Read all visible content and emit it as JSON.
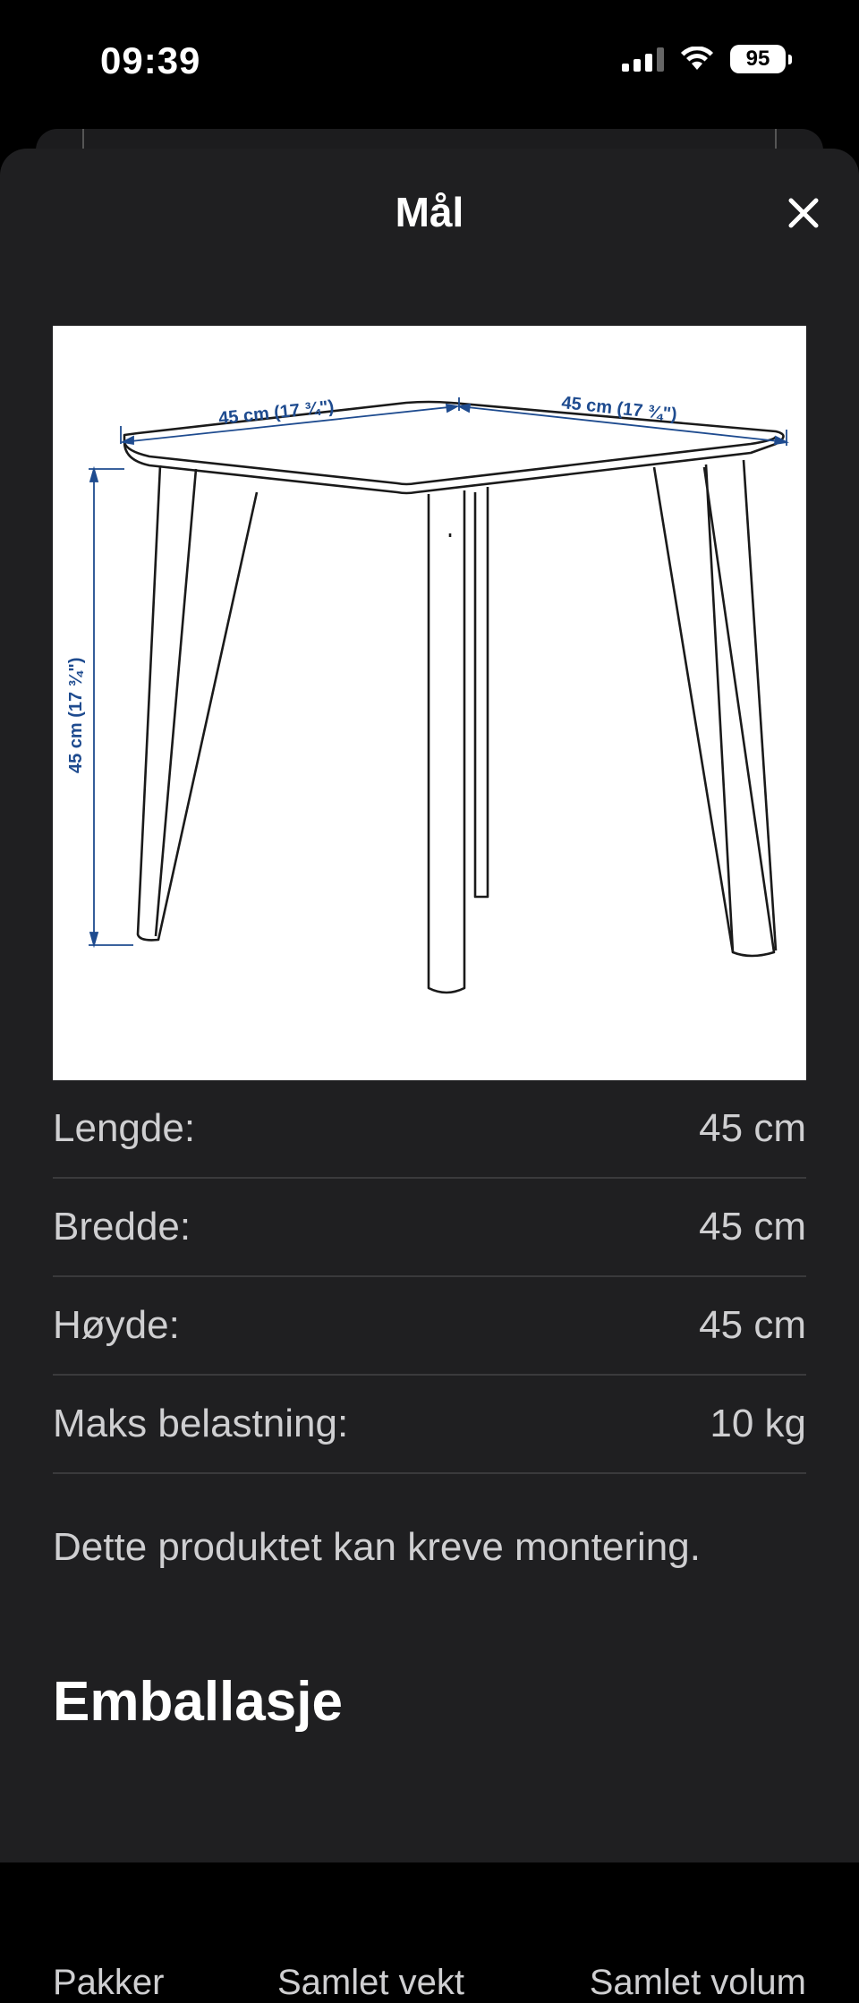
{
  "status": {
    "time": "09:39",
    "battery": "95"
  },
  "sheet": {
    "title": "Mål"
  },
  "diagram": {
    "top_left_dim": "45 cm (17 ¾\")",
    "top_right_dim": "45 cm (17 ¾\")",
    "height_dim": "45 cm (17 ¾\")"
  },
  "dimensions": [
    {
      "label": "Lengde:",
      "value": "45 cm"
    },
    {
      "label": "Bredde:",
      "value": "45 cm"
    },
    {
      "label": "Høyde:",
      "value": "45 cm"
    },
    {
      "label": "Maks belastning:",
      "value": "10 kg"
    }
  ],
  "note": "Dette produktet kan kreve montering.",
  "packaging": {
    "title": "Emballasje",
    "columns": [
      "Pakker",
      "Samlet vekt",
      "Samlet volum"
    ]
  }
}
